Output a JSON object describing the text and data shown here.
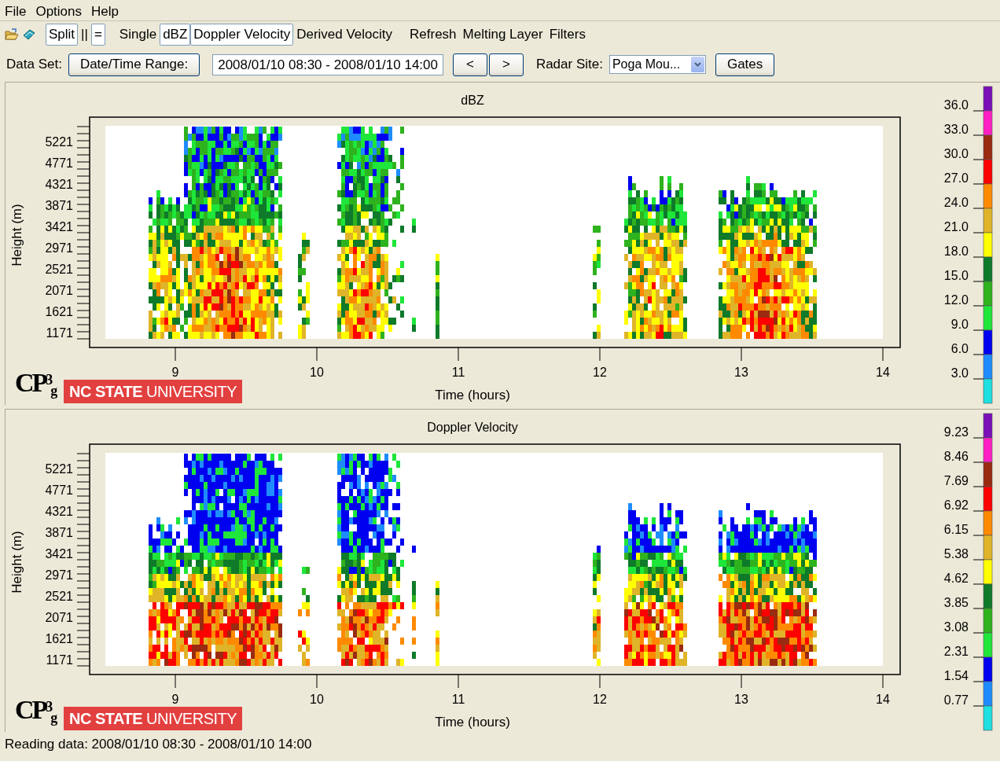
{
  "menu": [
    {
      "label": "File"
    },
    {
      "label": "Options"
    },
    {
      "label": "Help"
    }
  ],
  "toolbar": [
    {
      "items": [
        {
          "label": "Split",
          "selected": true
        },
        {
          "label": "||",
          "selected": false
        },
        {
          "label": "=",
          "selected": true
        }
      ]
    },
    {
      "items": [
        {
          "label": "Single",
          "selected": false
        },
        {
          "label": "dBZ",
          "selected": true
        },
        {
          "label": "Doppler Velocity",
          "selected": true
        },
        {
          "label": "Derived Velocity",
          "selected": false
        }
      ]
    },
    {
      "items": [
        {
          "label": "Refresh",
          "selected": false
        },
        {
          "label": "Melting Layer",
          "selected": false
        },
        {
          "label": "Filters",
          "selected": false
        }
      ]
    }
  ],
  "data_set": {
    "label": "Data Set:",
    "range_button": "Date/Time Range:",
    "range_value": "2008/01/10 08:30 - 2008/01/10 14:00",
    "prev": "<",
    "next": ">",
    "site_label": "Radar Site:",
    "site_value": "Poga Mou...",
    "gates": "Gates"
  },
  "panels": [
    {
      "title": "dBZ",
      "kind": "reflectivity",
      "ylabel": "Height (m)",
      "xlabel": "Time (hours)",
      "yticks": [
        "5221",
        "4771",
        "4321",
        "3871",
        "3421",
        "2971",
        "2521",
        "2071",
        "1621",
        "1171"
      ],
      "xticks": [
        "9",
        "10",
        "11",
        "12",
        "13",
        "14"
      ],
      "colorbar": {
        "ticks": [
          "36.0",
          "33.0",
          "30.0",
          "27.0",
          "24.0",
          "21.0",
          "18.0",
          "15.0",
          "12.0",
          "9.0",
          "6.0",
          "3.0"
        ],
        "segments": [
          {
            "color": "#7a0fb8"
          },
          {
            "color": "#ff1fc4"
          },
          {
            "color": "#9a2a10"
          },
          {
            "color": "#ff0000"
          },
          {
            "color": "#ff8a00"
          },
          {
            "color": "#e0b428"
          },
          {
            "color": "#ffff00"
          },
          {
            "color": "#0e7a2a"
          },
          {
            "color": "#2eb21e"
          },
          {
            "color": "#1ee63a"
          },
          {
            "color": "#0000f0"
          },
          {
            "color": "#1e8cff"
          },
          {
            "color": "#1ee0e0"
          }
        ]
      },
      "logo": "CP$^{3}$$_{g}$",
      "badge": "**NC STATE** UNIVERSITY"
    },
    {
      "title": "Doppler Velocity",
      "kind": "velocity",
      "ylabel": "Height (m)",
      "xlabel": "Time (hours)",
      "yticks": [
        "5221",
        "4771",
        "4321",
        "3871",
        "3421",
        "2971",
        "2521",
        "2071",
        "1621",
        "1171"
      ],
      "xticks": [
        "9",
        "10",
        "11",
        "12",
        "13",
        "14"
      ],
      "colorbar": {
        "ticks": [
          "9.23",
          "8.46",
          "7.69",
          "6.92",
          "6.15",
          "5.38",
          "4.62",
          "3.85",
          "3.08",
          "2.31",
          "1.54",
          "0.77"
        ],
        "segments": [
          {
            "color": "#7a0fb8"
          },
          {
            "color": "#ff1fc4"
          },
          {
            "color": "#9a2a10"
          },
          {
            "color": "#ff0000"
          },
          {
            "color": "#ff8a00"
          },
          {
            "color": "#e0b428"
          },
          {
            "color": "#ffff00"
          },
          {
            "color": "#0e7a2a"
          },
          {
            "color": "#2eb21e"
          },
          {
            "color": "#1ee63a"
          },
          {
            "color": "#0000f0"
          },
          {
            "color": "#1e8cff"
          },
          {
            "color": "#1ee0e0"
          }
        ]
      },
      "logo": "CP$^{3}$$_{g}$",
      "badge": "**NC STATE** UNIVERSITY"
    }
  ],
  "status_bar": "Reading data: 2008/01/10 08:30 - 2008/01/10 14:00"
}
